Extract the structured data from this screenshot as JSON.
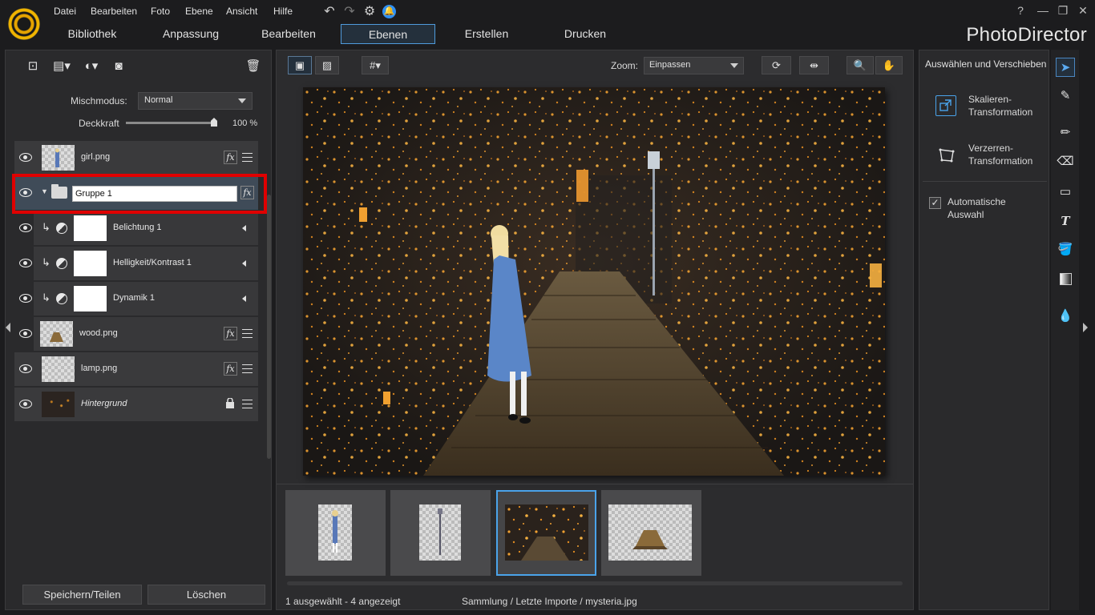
{
  "app": {
    "brand": "PhotoDirector"
  },
  "menu": [
    "Datei",
    "Bearbeiten",
    "Foto",
    "Ebene",
    "Ansicht",
    "Hilfe"
  ],
  "nav_tabs": [
    {
      "label": "Bibliothek",
      "active": false
    },
    {
      "label": "Anpassung",
      "active": false
    },
    {
      "label": "Bearbeiten",
      "active": false
    },
    {
      "label": "Ebenen",
      "active": true
    },
    {
      "label": "Erstellen",
      "active": false
    },
    {
      "label": "Drucken",
      "active": false
    }
  ],
  "window_controls": {
    "help": "?",
    "minimize": "—",
    "restore": "❐",
    "close": "✕"
  },
  "layers_panel": {
    "blend_mode_label": "Mischmodus:",
    "blend_mode_value": "Normal",
    "opacity_label": "Deckkraft",
    "opacity_value": "100 %",
    "opacity_fraction": 1.0,
    "layers": [
      {
        "name": "girl.png",
        "visible": true,
        "type": "image"
      },
      {
        "name": "Gruppe 1",
        "visible": true,
        "type": "group",
        "editing": true
      },
      {
        "name": "Belichtung 1",
        "visible": true,
        "type": "adjustment"
      },
      {
        "name": "Helligkeit/Kontrast 1",
        "visible": true,
        "type": "adjustment"
      },
      {
        "name": "Dynamik 1",
        "visible": true,
        "type": "adjustment"
      },
      {
        "name": "wood.png",
        "visible": true,
        "type": "image"
      },
      {
        "name": "lamp.png",
        "visible": true,
        "type": "image"
      },
      {
        "name": "Hintergrund",
        "visible": true,
        "type": "background",
        "locked": true
      }
    ],
    "save_share_label": "Speichern/Teilen",
    "delete_label": "Löschen"
  },
  "viewer": {
    "zoom_label": "Zoom:",
    "zoom_value": "Einpassen",
    "status_count": "1 ausgewählt - 4 angezeigt",
    "status_path": "Sammlung / Letzte Importe / mysteria.jpg",
    "filmstrip": [
      {
        "content": "girl"
      },
      {
        "content": "lamp"
      },
      {
        "content": "background",
        "selected": true
      },
      {
        "content": "wood"
      }
    ]
  },
  "tool_panel": {
    "title": "Auswählen und Verschieben",
    "scale_label": "Skalieren-\nTransformation",
    "scale_label_l1": "Skalieren-",
    "scale_label_l2": "Transformation",
    "distort_label_l1": "Verzerren-",
    "distort_label_l2": "Transformation",
    "auto_select_l1": "Automatische",
    "auto_select_l2": "Auswahl",
    "auto_select_checked": true
  },
  "colors": {
    "accent": "#4aa3ea",
    "highlight": "#e00000",
    "background": "#1c1c1e",
    "panel": "#2a2a2c"
  }
}
